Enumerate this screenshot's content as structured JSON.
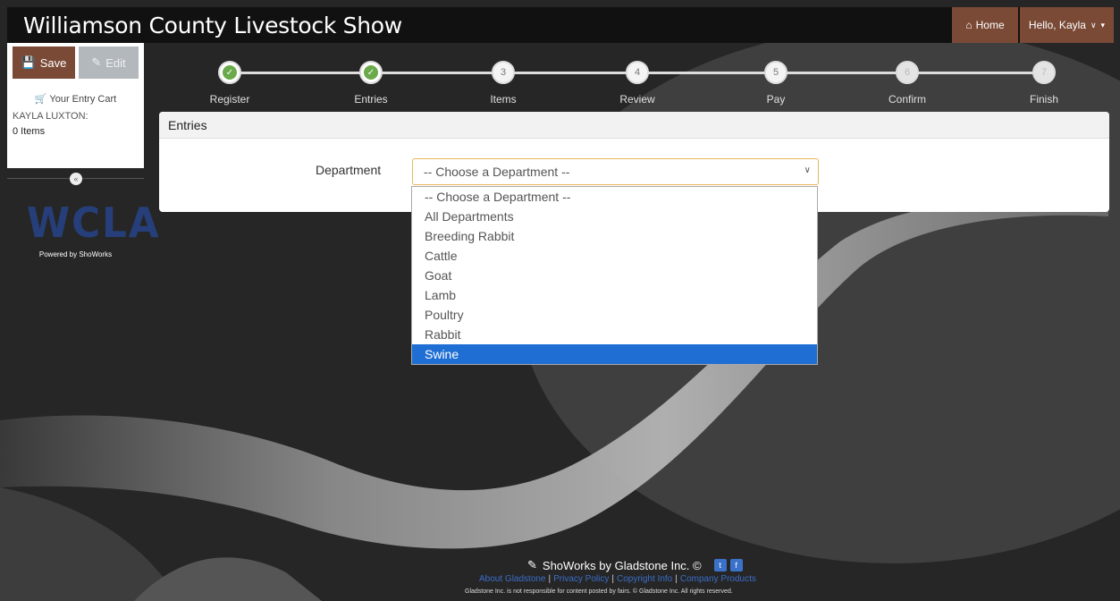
{
  "header": {
    "title": "Williamson County Livestock Show",
    "home_label": "Home",
    "user_greeting": "Hello, Kayla"
  },
  "sidebar": {
    "save_label": "Save",
    "edit_label": "Edit",
    "cart_label": "Your Entry Cart",
    "cart_owner": "KAYLA LUXTON:",
    "cart_count": "0 Items",
    "logo_text": "WCLA",
    "powered_by": "Powered by ShoWorks"
  },
  "steps": [
    {
      "label": "Register",
      "number": "",
      "state": "done"
    },
    {
      "label": "Entries",
      "number": "",
      "state": "done"
    },
    {
      "label": "Items",
      "number": "3",
      "state": "todo"
    },
    {
      "label": "Review",
      "number": "4",
      "state": "todo"
    },
    {
      "label": "Pay",
      "number": "5",
      "state": "todo"
    },
    {
      "label": "Confirm",
      "number": "6",
      "state": "faded"
    },
    {
      "label": "Finish",
      "number": "7",
      "state": "faded"
    }
  ],
  "panel": {
    "title": "Entries",
    "department_label": "Department",
    "department_value": "-- Choose a Department --"
  },
  "dropdown": {
    "options": [
      "-- Choose a Department --",
      "All Departments",
      "Breeding Rabbit",
      "Cattle",
      "Goat",
      "Lamb",
      "Poultry",
      "Rabbit",
      "Swine"
    ],
    "highlighted": "Swine"
  },
  "footer": {
    "brand": "ShoWorks by Gladstone Inc. ©",
    "links": [
      "About Gladstone",
      "Privacy Policy",
      "Copyright Info",
      "Company Products"
    ],
    "legal": "Gladstone Inc. is not responsible for content posted by fairs. © Gladstone Inc. All rights reserved."
  },
  "colors": {
    "accent_brown": "#7a4a36",
    "selected_blue": "#1e6ed4",
    "check_green": "#6aaa4a",
    "logo_navy": "#263f7a"
  }
}
